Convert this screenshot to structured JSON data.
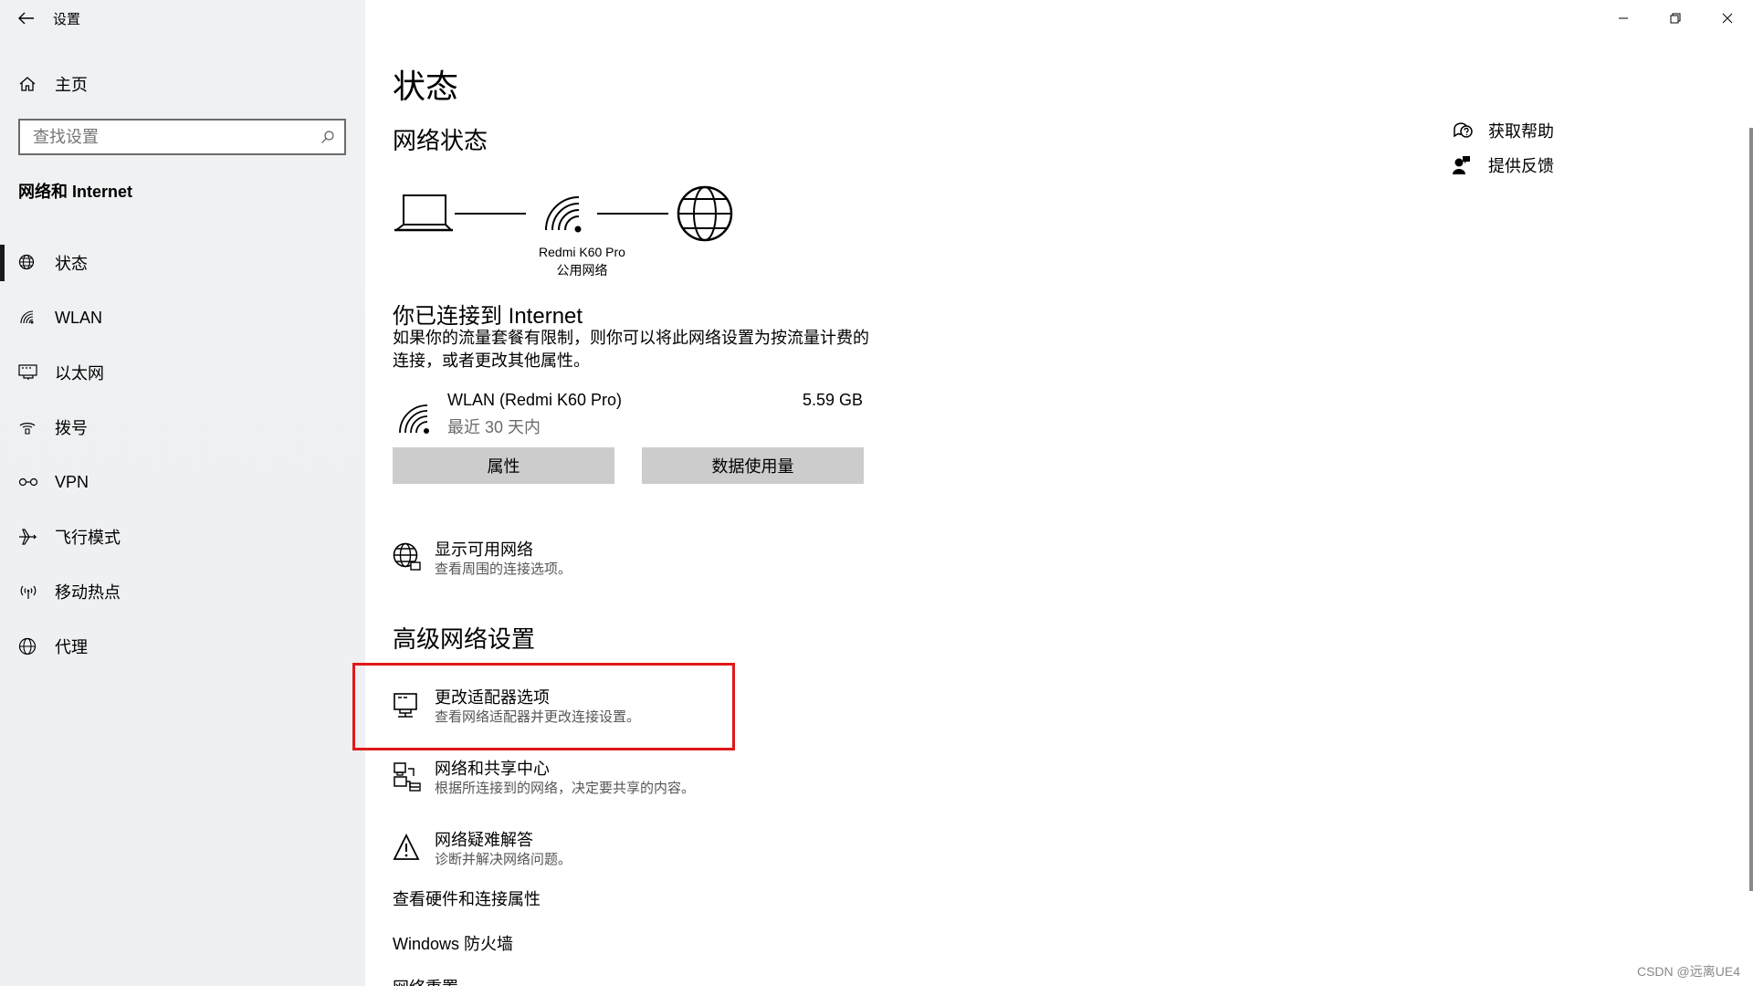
{
  "window": {
    "title": "设置",
    "controls": [
      "minimize",
      "restore",
      "close"
    ]
  },
  "sidebar": {
    "home_label": "主页",
    "search_placeholder": "查找设置",
    "section_title": "网络和 Internet",
    "items": [
      {
        "label": "状态",
        "icon": "globe-status-icon",
        "active": true
      },
      {
        "label": "WLAN",
        "icon": "wifi-icon"
      },
      {
        "label": "以太网",
        "icon": "ethernet-icon"
      },
      {
        "label": "拨号",
        "icon": "dialup-icon"
      },
      {
        "label": "VPN",
        "icon": "vpn-icon"
      },
      {
        "label": "飞行模式",
        "icon": "airplane-icon"
      },
      {
        "label": "移动热点",
        "icon": "hotspot-icon"
      },
      {
        "label": "代理",
        "icon": "globe-icon"
      }
    ]
  },
  "main": {
    "title": "状态",
    "network_status_heading": "网络状态",
    "network_name": "Redmi K60 Pro",
    "network_type": "公用网络",
    "connected_title": "你已连接到 Internet",
    "connected_desc": "如果你的流量套餐有限制，则你可以将此网络设置为按流量计费的连接，或者更改其他属性。",
    "connection": {
      "name": "WLAN (Redmi K60 Pro)",
      "period": "最近 30 天内",
      "usage": "5.59 GB"
    },
    "buttons": {
      "properties": "属性",
      "data_usage": "数据使用量"
    },
    "show_networks": {
      "title": "显示可用网络",
      "subtitle": "查看周围的连接选项。"
    },
    "advanced_heading": "高级网络设置",
    "advanced_items": [
      {
        "title": "更改适配器选项",
        "subtitle": "查看网络适配器并更改连接设置。"
      },
      {
        "title": "网络和共享中心",
        "subtitle": "根据所连接到的网络，决定要共享的内容。"
      },
      {
        "title": "网络疑难解答",
        "subtitle": "诊断并解决网络问题。"
      }
    ],
    "links": {
      "hardware": "查看硬件和连接属性",
      "firewall": "Windows 防火墙",
      "reset": "网络重置"
    }
  },
  "help": {
    "get_help": "获取帮助",
    "feedback": "提供反馈"
  },
  "watermark": "CSDN @远离UE4",
  "colors": {
    "highlight": "#e01919",
    "button_bg": "#cccccc",
    "sidebar_bg": "#eef0f2"
  }
}
